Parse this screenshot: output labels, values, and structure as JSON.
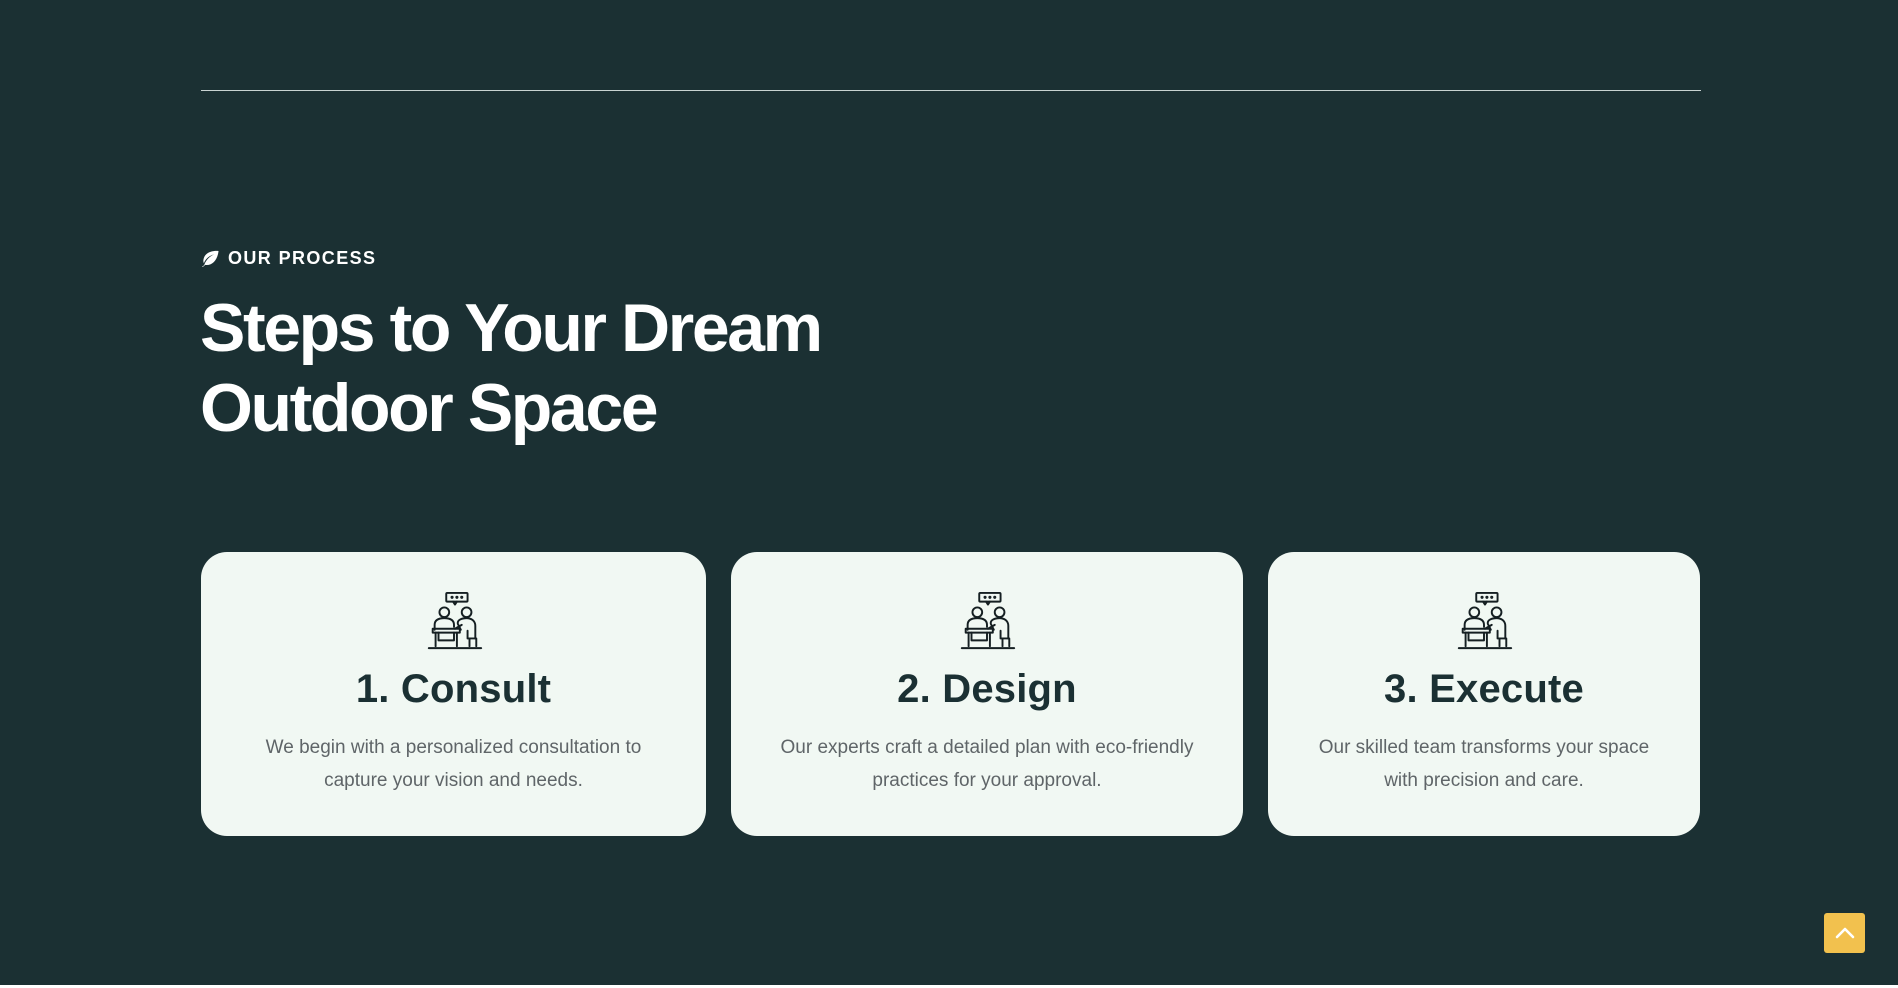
{
  "section": {
    "eyebrow": "OUR PROCESS",
    "eyebrow_icon": "leaf-icon",
    "title_line1": "Steps to Your Dream",
    "title_line2": "Outdoor Space"
  },
  "steps": [
    {
      "icon": "consultation-icon",
      "title": "1. Consult",
      "description": "We begin with a personalized consultation to capture your vision and needs."
    },
    {
      "icon": "consultation-icon",
      "title": "2. Design",
      "description": "Our experts craft a detailed plan with eco-friendly practices for your approval."
    },
    {
      "icon": "consultation-icon",
      "title": "3. Execute",
      "description": "Our skilled team transforms your space with precision and care."
    }
  ],
  "scroll_to_top": {
    "icon": "chevron-up-icon"
  },
  "colors": {
    "section_bg": "#1b3033",
    "card_bg": "#f1f8f3",
    "heading_text": "#1b3033",
    "body_text": "#5f6568",
    "accent": "#f2c14e"
  }
}
